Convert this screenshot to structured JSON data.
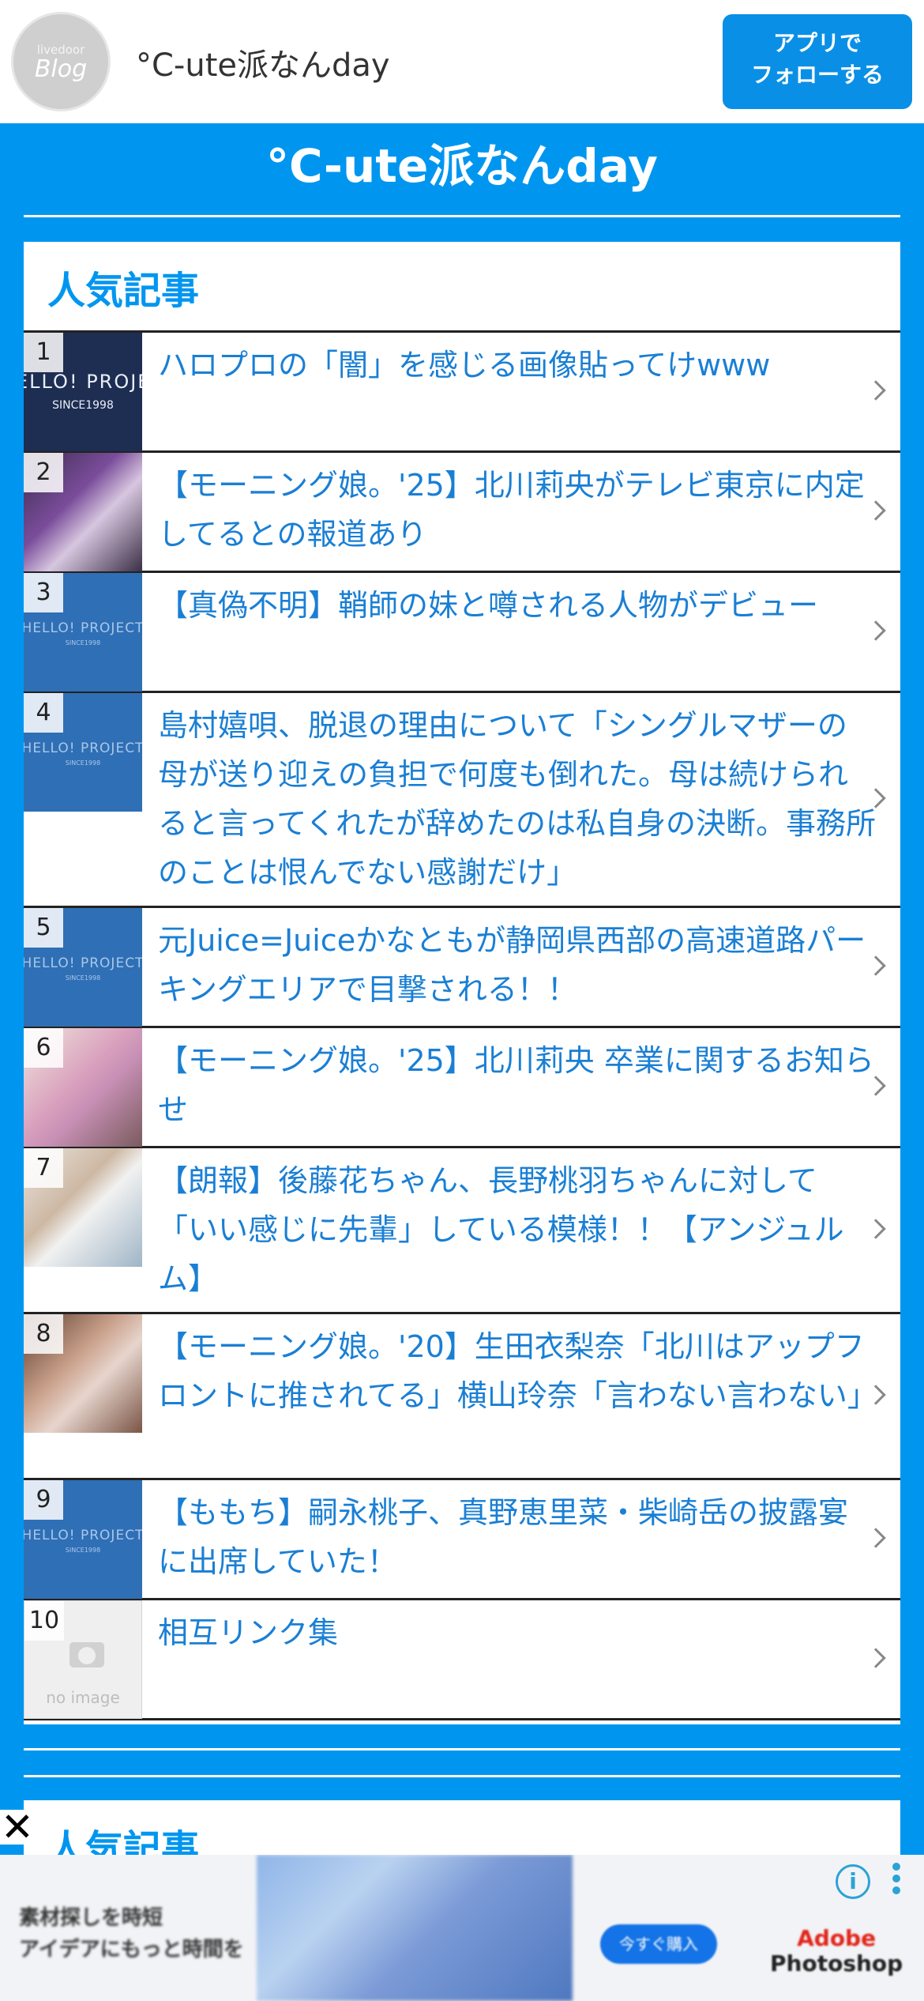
{
  "header": {
    "logo_top": "livedoor",
    "logo_main": "Blog",
    "blog_name": "°C-ute派なんday",
    "follow_button": [
      "アプリで",
      "フォローする"
    ]
  },
  "site_title": "°C-ute派なんday",
  "popular": {
    "title": "人気記事",
    "items": [
      {
        "rank": "1",
        "title": "ハロプロの「闇」を感じる画像貼ってけwww",
        "thumb": "HELLO! PROJECT SINCE1998 navy"
      },
      {
        "rank": "2",
        "title": "【モーニング娘。'25】北川莉央がテレビ東京に内定してるとの報道あり",
        "thumb": "photo"
      },
      {
        "rank": "3",
        "title": "【真偽不明】鞘師の妹と噂される人物がデビュー",
        "thumb": "HELLO! PROJECT"
      },
      {
        "rank": "4",
        "title": "島村嬉唄、脱退の理由について「シングルマザーの母が送り迎えの負担で何度も倒れた。母は続けられると言ってくれたが辞めたのは私自身の決断。事務所のことは恨んでない感謝だけ」",
        "thumb": "HELLO! PROJECT"
      },
      {
        "rank": "5",
        "title": "元Juice=Juiceかなともが静岡県西部の高速道路パーキングエリアで目撃される！！",
        "thumb": "HELLO! PROJECT"
      },
      {
        "rank": "6",
        "title": "【モーニング娘。'25】北川莉央 卒業に関するお知らせ",
        "thumb": "photo"
      },
      {
        "rank": "7",
        "title": "【朗報】後藤花ちゃん、長野桃羽ちゃんに対して「いい感じに先輩」している模様！！【アンジュルム】",
        "thumb": "photo"
      },
      {
        "rank": "8",
        "title": "【モーニング娘。'20】生田衣梨奈「北川はアップフロントに推されてる」横山玲奈「言わない言わない」",
        "thumb": "photo"
      },
      {
        "rank": "9",
        "title": "【ももち】嗣永桃子、真野恵里菜・柴崎岳の披露宴に出席していた！",
        "thumb": "HELLO! PROJECT"
      },
      {
        "rank": "10",
        "title": "相互リンク集",
        "thumb": "no image"
      }
    ]
  },
  "popular2": {
    "title": "人気記事"
  },
  "thumb_text": {
    "hp": "HELLO! PROJECT",
    "since": "SINCE1998",
    "hp_navy": "ELLO! PROJE",
    "noimage": "no image"
  },
  "ad": {
    "close": "✕",
    "copy": [
      "素材探しを時短",
      "アイデアにもっと時間を"
    ],
    "cta": "今すぐ購入",
    "brand": [
      "Adobe",
      "Photoshop"
    ],
    "info": "i"
  },
  "colors": {
    "brand_blue": "#0096f0",
    "link_blue": "#1a7fd4"
  }
}
